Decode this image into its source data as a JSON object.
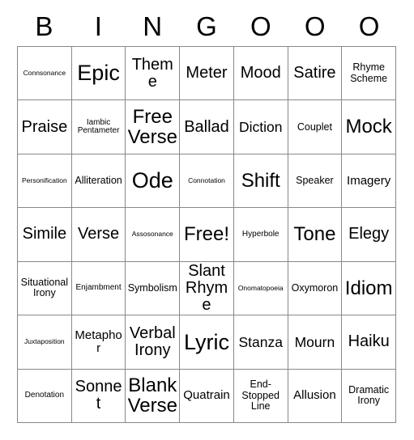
{
  "header": {
    "letters": [
      "B",
      "I",
      "N",
      "G",
      "O",
      "O",
      "O"
    ]
  },
  "grid": {
    "columns": 7,
    "rows": 7,
    "free_space_label": "Free!",
    "cells": [
      [
        {
          "label": "Connsonance",
          "size": "s-xxs"
        },
        {
          "label": "Epic",
          "size": "s-hg"
        },
        {
          "label": "Theme",
          "size": "s-xl"
        },
        {
          "label": "Meter",
          "size": "s-xl"
        },
        {
          "label": "Mood",
          "size": "s-xl"
        },
        {
          "label": "Satire",
          "size": "s-xl"
        },
        {
          "label": "Rhyme Scheme",
          "size": "s-sm"
        }
      ],
      [
        {
          "label": "Praise",
          "size": "s-xl"
        },
        {
          "label": "Iambic Pentameter",
          "size": "s-xs"
        },
        {
          "label": "Free Verse",
          "size": "s-xxl"
        },
        {
          "label": "Ballad",
          "size": "s-xl"
        },
        {
          "label": "Diction",
          "size": "s-lg"
        },
        {
          "label": "Couplet",
          "size": "s-sm"
        },
        {
          "label": "Mock",
          "size": "s-xxl"
        }
      ],
      [
        {
          "label": "Personification",
          "size": "s-xxs"
        },
        {
          "label": "Alliteration",
          "size": "s-sm"
        },
        {
          "label": "Ode",
          "size": "s-hg"
        },
        {
          "label": "Connotation",
          "size": "s-xxs"
        },
        {
          "label": "Shift",
          "size": "s-xxl"
        },
        {
          "label": "Speaker",
          "size": "s-sm"
        },
        {
          "label": "Imagery",
          "size": "s-md"
        }
      ],
      [
        {
          "label": "Simile",
          "size": "s-xl"
        },
        {
          "label": "Verse",
          "size": "s-xl"
        },
        {
          "label": "Assosonance",
          "size": "s-xxs"
        },
        {
          "label": "Free!",
          "size": "s-xxl"
        },
        {
          "label": "Hyperbole",
          "size": "s-xs"
        },
        {
          "label": "Tone",
          "size": "s-xxl"
        },
        {
          "label": "Elegy",
          "size": "s-xl"
        }
      ],
      [
        {
          "label": "Situational Irony",
          "size": "s-sm"
        },
        {
          "label": "Enjambment",
          "size": "s-xs"
        },
        {
          "label": "Symbolism",
          "size": "s-sm"
        },
        {
          "label": "Slant Rhyme",
          "size": "s-xl"
        },
        {
          "label": "Onomatopoeia",
          "size": "s-xxs"
        },
        {
          "label": "Oxymoron",
          "size": "s-sm"
        },
        {
          "label": "Idiom",
          "size": "s-xxl"
        }
      ],
      [
        {
          "label": "Juxtaposition",
          "size": "s-xxs"
        },
        {
          "label": "Metaphor",
          "size": "s-md"
        },
        {
          "label": "Verbal Irony",
          "size": "s-xl"
        },
        {
          "label": "Lyric",
          "size": "s-hg"
        },
        {
          "label": "Stanza",
          "size": "s-lg"
        },
        {
          "label": "Mourn",
          "size": "s-lg"
        },
        {
          "label": "Haiku",
          "size": "s-xl"
        }
      ],
      [
        {
          "label": "Denotation",
          "size": "s-xs"
        },
        {
          "label": "Sonnet",
          "size": "s-xl"
        },
        {
          "label": "Blank Verse",
          "size": "s-xxl"
        },
        {
          "label": "Quatrain",
          "size": "s-md"
        },
        {
          "label": "End-Stopped Line",
          "size": "s-sm"
        },
        {
          "label": "Allusion",
          "size": "s-md"
        },
        {
          "label": "Dramatic Irony",
          "size": "s-sm"
        }
      ]
    ]
  },
  "colors": {
    "background": "#ffffff",
    "text": "#000000",
    "border": "#888888"
  }
}
